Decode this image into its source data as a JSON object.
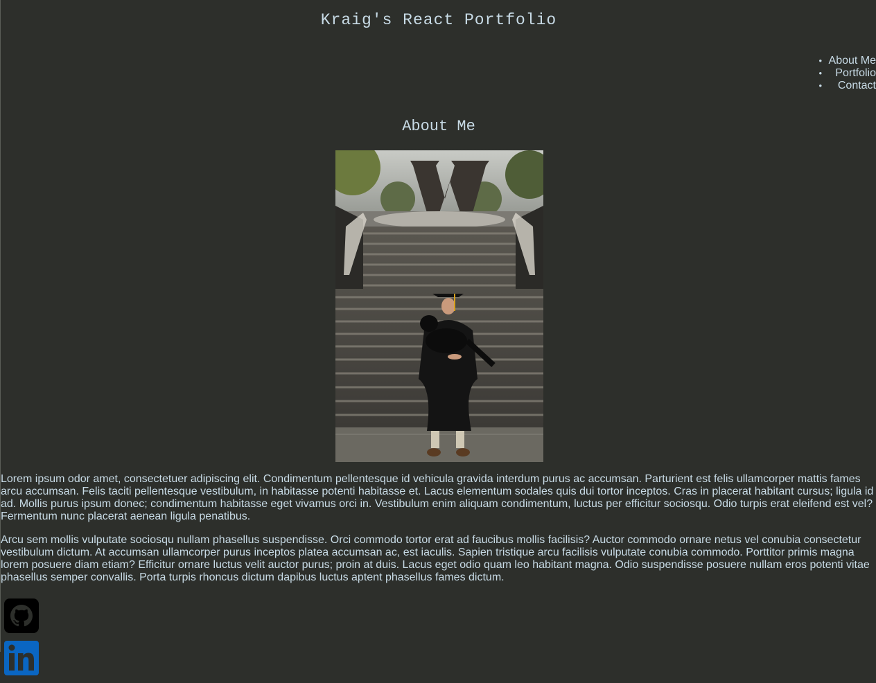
{
  "header": {
    "title": "Kraig's React Portfolio"
  },
  "nav": {
    "items": [
      {
        "label": "About Me"
      },
      {
        "label": "Portfolio"
      },
      {
        "label": "Contact"
      }
    ]
  },
  "about": {
    "heading": "About Me",
    "paragraphs": [
      "Lorem ipsum odor amet, consectetuer adipiscing elit. Condimentum pellentesque id vehicula gravida interdum purus ac accumsan. Parturient est felis ullamcorper mattis fames arcu accumsan. Felis taciti pellentesque vestibulum, in habitasse potenti habitasse et. Lacus elementum sodales quis dui tortor inceptos. Cras in placerat habitant cursus; ligula id ad. Mollis purus ipsum donec; condimentum habitasse eget vivamus orci in. Vestibulum enim aliquam condimentum, luctus per efficitur sociosqu. Odio turpis erat eleifend est vel? Fermentum nunc placerat aenean ligula penatibus.",
      "Arcu sem mollis vulputate sociosqu nullam phasellus suspendisse. Orci commodo tortor erat ad faucibus mollis facilisis? Auctor commodo ornare netus vel conubia consectetur vestibulum dictum. At accumsan ullamcorper purus inceptos platea accumsan ac, est iaculis. Sapien tristique arcu facilisis vulputate conubia commodo. Porttitor primis magna lorem posuere diam etiam? Efficitur ornare luctus velit auctor purus; proin at duis. Lacus eget odio quam leo habitant magna. Odio suspendisse posuere nullam eros potenti vitae phasellus semper convallis. Porta turpis rhoncus dictum dapibus luctus aptent phasellus fames dictum."
    ]
  },
  "socials": [
    {
      "icon": "github-icon"
    },
    {
      "icon": "linkedin-icon"
    }
  ],
  "colors": {
    "background": "#2d2f2b",
    "text": "#c8dbe6",
    "linkedin": "#0a66c2"
  }
}
